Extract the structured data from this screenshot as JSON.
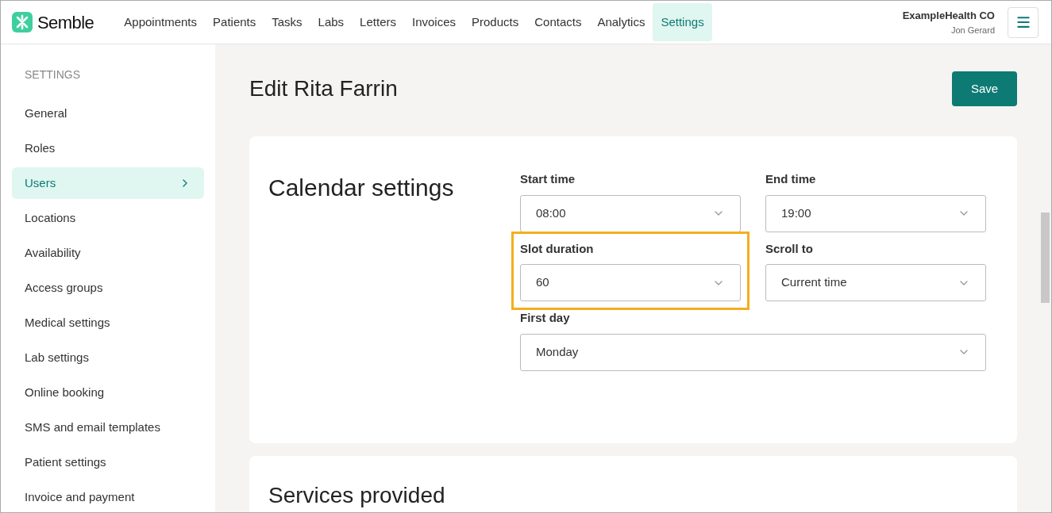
{
  "brand": "Semble",
  "nav": [
    {
      "label": "Appointments",
      "selected": false
    },
    {
      "label": "Patients",
      "selected": false
    },
    {
      "label": "Tasks",
      "selected": false
    },
    {
      "label": "Labs",
      "selected": false
    },
    {
      "label": "Letters",
      "selected": false
    },
    {
      "label": "Invoices",
      "selected": false
    },
    {
      "label": "Products",
      "selected": false
    },
    {
      "label": "Contacts",
      "selected": false
    },
    {
      "label": "Analytics",
      "selected": false
    },
    {
      "label": "Settings",
      "selected": true
    }
  ],
  "account": {
    "organization": "ExampleHealth CO",
    "user": "Jon Gerard"
  },
  "sidebar": {
    "heading": "SETTINGS",
    "items": [
      {
        "label": "General",
        "selected": false
      },
      {
        "label": "Roles",
        "selected": false
      },
      {
        "label": "Users",
        "selected": true
      },
      {
        "label": "Locations",
        "selected": false
      },
      {
        "label": "Availability",
        "selected": false
      },
      {
        "label": "Access groups",
        "selected": false
      },
      {
        "label": "Medical settings",
        "selected": false
      },
      {
        "label": "Lab settings",
        "selected": false
      },
      {
        "label": "Online booking",
        "selected": false
      },
      {
        "label": "SMS and email templates",
        "selected": false
      },
      {
        "label": "Patient settings",
        "selected": false
      },
      {
        "label": "Invoice and payment",
        "selected": false
      }
    ]
  },
  "page": {
    "title": "Edit Rita Farrin",
    "save_button": "Save"
  },
  "calendar_settings": {
    "title": "Calendar settings",
    "fields": [
      {
        "label": "Start time",
        "value": "08:00",
        "highlighted": false,
        "wide": false
      },
      {
        "label": "End time",
        "value": "19:00",
        "highlighted": false,
        "wide": false
      },
      {
        "label": "Slot duration",
        "value": "60",
        "highlighted": true,
        "wide": false
      },
      {
        "label": "Scroll to",
        "value": "Current time",
        "highlighted": false,
        "wide": false
      },
      {
        "label": "First day",
        "value": "Monday",
        "highlighted": false,
        "wide": true
      }
    ]
  },
  "services": {
    "title": "Services provided"
  }
}
